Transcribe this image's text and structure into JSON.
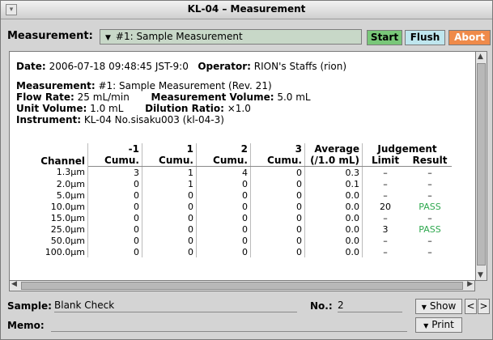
{
  "window": {
    "title": "KL-04 – Measurement"
  },
  "toolbar": {
    "measurement_label": "Measurement:",
    "measurement_value": "#1: Sample Measurement",
    "start_label": "Start",
    "flush_label": "Flush",
    "abort_label": "Abort",
    "colors": {
      "start": "#79c779",
      "flush": "#bfe6ee",
      "abort": "#ef8a4a"
    }
  },
  "info": {
    "date_label": "Date:",
    "date_value": "2006-07-18 09:48:45 JST-9:0",
    "operator_label": "Operator:",
    "operator_value": "RION's Staffs (rion)",
    "measurement_label": "Measurement:",
    "measurement_value": "#1: Sample Measurement (Rev. 21)",
    "flow_rate_label": "Flow Rate:",
    "flow_rate_value": "25 mL/min",
    "meas_volume_label": "Measurement Volume:",
    "meas_volume_value": "5.0 mL",
    "unit_volume_label": "Unit Volume:",
    "unit_volume_value": "1.0 mL",
    "dilution_label": "Dilution Ratio:",
    "dilution_value": "×1.0",
    "instrument_label": "Instrument:",
    "instrument_value": "KL-04 No.sisaku003 (kl-04-3)"
  },
  "table": {
    "headers": {
      "channel": "Channel",
      "col_m1": "-1",
      "col_1": "1",
      "col_2": "2",
      "col_3": "3",
      "cumu": "Cumu.",
      "average": "Average",
      "average_unit": "(/1.0 mL)",
      "judgement": "Judgement",
      "limit": "Limit",
      "result": "Result"
    },
    "rows": [
      {
        "channel": "1.3µm",
        "m1": "3",
        "c1": "1",
        "c2": "4",
        "c3": "0",
        "avg": "0.3",
        "limit": "–",
        "result": "–"
      },
      {
        "channel": "2.0µm",
        "m1": "0",
        "c1": "1",
        "c2": "0",
        "c3": "0",
        "avg": "0.1",
        "limit": "–",
        "result": "–"
      },
      {
        "channel": "5.0µm",
        "m1": "0",
        "c1": "0",
        "c2": "0",
        "c3": "0",
        "avg": "0.0",
        "limit": "–",
        "result": "–"
      },
      {
        "channel": "10.0µm",
        "m1": "0",
        "c1": "0",
        "c2": "0",
        "c3": "0",
        "avg": "0.0",
        "limit": "20",
        "result": "PASS"
      },
      {
        "channel": "15.0µm",
        "m1": "0",
        "c1": "0",
        "c2": "0",
        "c3": "0",
        "avg": "0.0",
        "limit": "–",
        "result": "–"
      },
      {
        "channel": "25.0µm",
        "m1": "0",
        "c1": "0",
        "c2": "0",
        "c3": "0",
        "avg": "0.0",
        "limit": "3",
        "result": "PASS"
      },
      {
        "channel": "50.0µm",
        "m1": "0",
        "c1": "0",
        "c2": "0",
        "c3": "0",
        "avg": "0.0",
        "limit": "–",
        "result": "–"
      },
      {
        "channel": "100.0µm",
        "m1": "0",
        "c1": "0",
        "c2": "0",
        "c3": "0",
        "avg": "0.0",
        "limit": "–",
        "result": "–"
      }
    ]
  },
  "bottom": {
    "sample_label": "Sample:",
    "sample_value": "Blank Check",
    "no_label": "No.:",
    "no_value": "2",
    "memo_label": "Memo:",
    "memo_value": "",
    "show_label": "Show",
    "print_label": "Print",
    "prev_label": "<",
    "next_label": ">"
  }
}
